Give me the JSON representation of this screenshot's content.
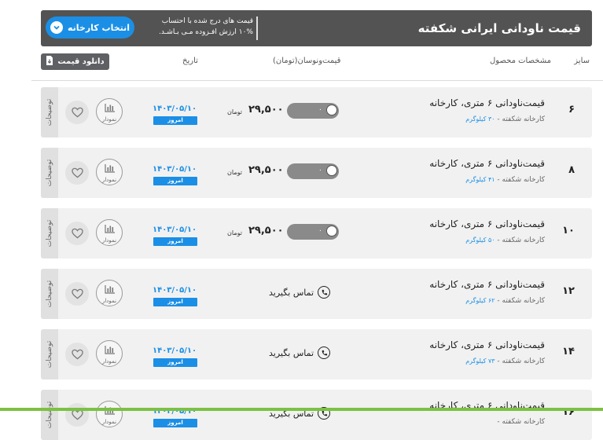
{
  "header": {
    "title": "قیمت ناودانی ایرانی شکفته",
    "note_line1": "قیمت های درج شده با احتساب",
    "note_line2": "۱۰% ارزش افـزوده مـی بـاشـد.",
    "select_button": "انتخاب کارخانه"
  },
  "columns": {
    "size": "سایز",
    "specs": "مشخصات محصول",
    "price": "قیمت‌ونوسان(تومان)",
    "date": "تاریخ",
    "download": "دانلود قیمت"
  },
  "labels": {
    "details": "توضیحات",
    "chart": "نمودار",
    "today": "امروز",
    "currency": "تومان",
    "contact": "تماس بگیرید"
  },
  "rows": [
    {
      "size": "۶",
      "name": "قیمت‌ناودانی ۶ متری، کارخانه",
      "factory": "کارخانه شکفته -",
      "weight": "۳۰ کیلوگرم",
      "price": "۲۹,۵۰۰",
      "change": "۰",
      "date": "۱۴۰۳/۰۵/۱۰",
      "has_price": true
    },
    {
      "size": "۸",
      "name": "قیمت‌ناودانی ۶ متری، کارخانه",
      "factory": "کارخانه شکفته -",
      "weight": "۴۱ کیلوگرم",
      "price": "۲۹,۵۰۰",
      "change": "۰",
      "date": "۱۴۰۳/۰۵/۱۰",
      "has_price": true
    },
    {
      "size": "۱۰",
      "name": "قیمت‌ناودانی ۶ متری، کارخانه",
      "factory": "کارخانه شکفته -",
      "weight": "۵۰ کیلوگرم",
      "price": "۲۹,۵۰۰",
      "change": "۰",
      "date": "۱۴۰۳/۰۵/۱۰",
      "has_price": true
    },
    {
      "size": "۱۲",
      "name": "قیمت‌ناودانی ۶ متری، کارخانه",
      "factory": "کارخانه شکفته -",
      "weight": "۶۲ کیلوگرم",
      "price": "",
      "change": "",
      "date": "۱۴۰۳/۰۵/۱۰",
      "has_price": false
    },
    {
      "size": "۱۴",
      "name": "قیمت‌ناودانی ۶ متری، کارخانه",
      "factory": "کارخانه شکفته -",
      "weight": "۷۳ کیلوگرم",
      "price": "",
      "change": "",
      "date": "۱۴۰۳/۰۵/۱۰",
      "has_price": false
    },
    {
      "size": "۱۶",
      "name": "قیمت‌ناودانی ۶ متری، کارخانه",
      "factory": "کارخانه شکفته -",
      "weight": "",
      "price": "",
      "change": "",
      "date": "۱۴۰۳/۰۵/۱۰",
      "has_price": false
    }
  ],
  "colors": {
    "accent": "#1b8fe6",
    "header_bg": "#535353",
    "row_bg": "#f1f1f1",
    "bottom_bar": "#7cc142"
  }
}
